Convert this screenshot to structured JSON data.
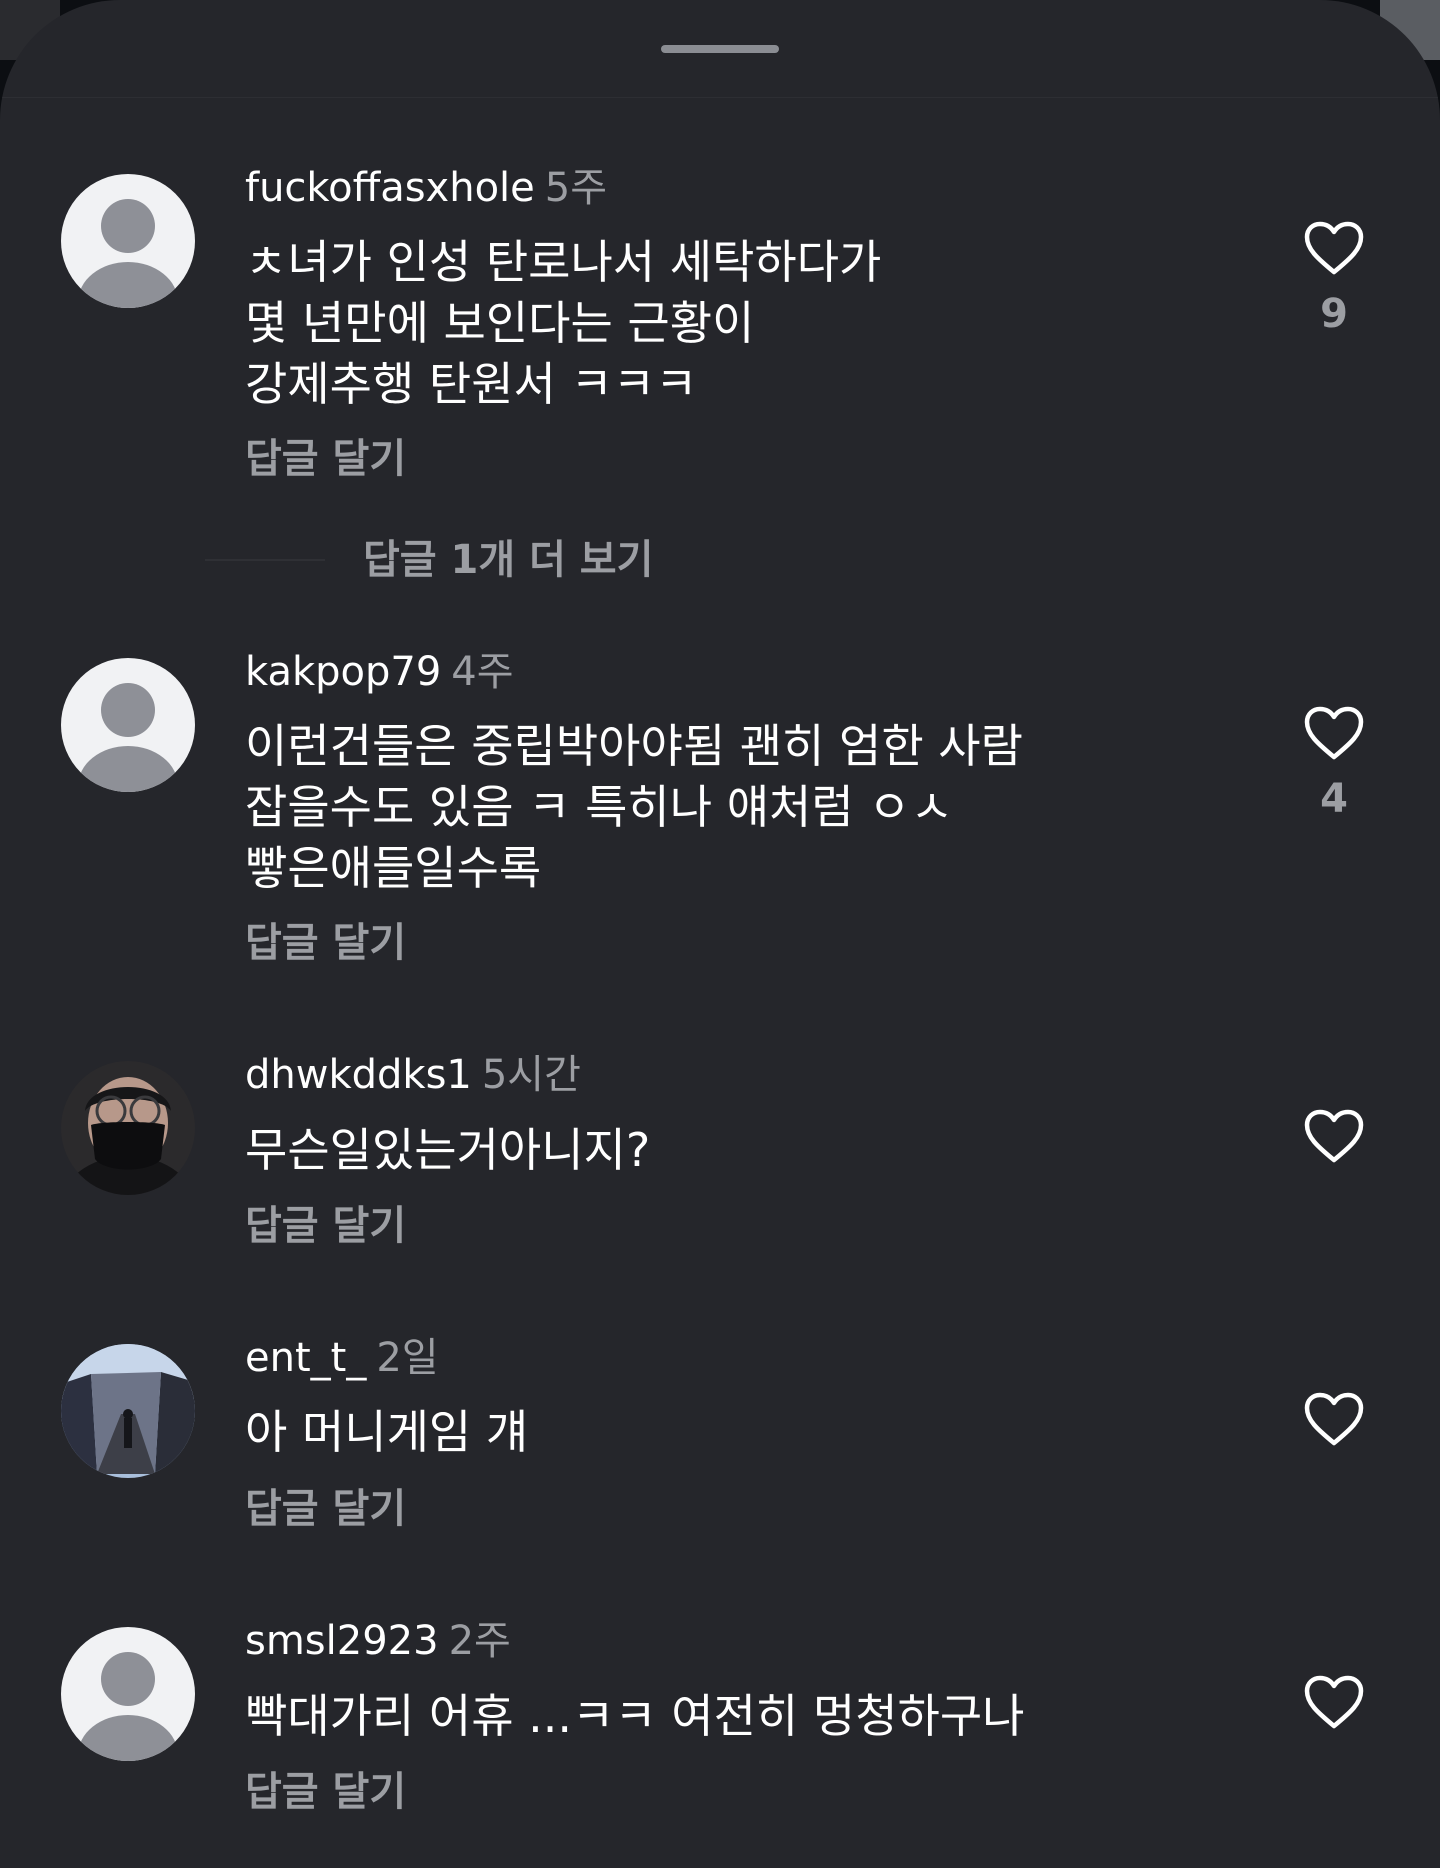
{
  "comments": [
    {
      "username": "fuckoffasxhole",
      "time": "5주",
      "text": "ㅊ녀가 인성 탄로나서 세탁하다가\n몇 년만에 보인다는 근황이\n강제추행 탄원서 ㅋㅋㅋ",
      "reply_label": "답글 달기",
      "likes": "9",
      "avatar": "default-avatar"
    },
    {
      "username": "kakpop79",
      "time": "4주",
      "text": "이런건들은 중립박아야됨 괜히 엄한 사람\n잡을수도 있음 ㅋ 특히나 얘처럼 ㅇㅅ\n빻은애들일수록",
      "reply_label": "답글 달기",
      "likes": "4",
      "avatar": "default-avatar"
    },
    {
      "username": "dhwkddks1",
      "time": "5시간",
      "text": "무슨일있는거아니지?",
      "reply_label": "답글 달기",
      "likes": "",
      "avatar": "photo-masked-person"
    },
    {
      "username": "ent_t_",
      "time": "2일",
      "text": "아 머니게임 걔",
      "reply_label": "답글 달기",
      "likes": "",
      "avatar": "photo-street"
    },
    {
      "username": "smsl2923",
      "time": "2주",
      "text": "빡대가리 어휴 ...ㅋㅋ 여전히 멍청하구나",
      "reply_label": "답글 달기",
      "likes": "",
      "avatar": "default-avatar"
    }
  ],
  "more_replies_label": "답글 1개 더 보기",
  "icons": {
    "like": "heart-outline-icon",
    "handle": "drag-handle"
  },
  "colors": {
    "background": "#25262b",
    "primary_text": "#ffffff",
    "secondary_text": "#9c9ea3",
    "default_avatar_bg": "#f1f2f4",
    "default_avatar_fg": "#8e9097"
  }
}
